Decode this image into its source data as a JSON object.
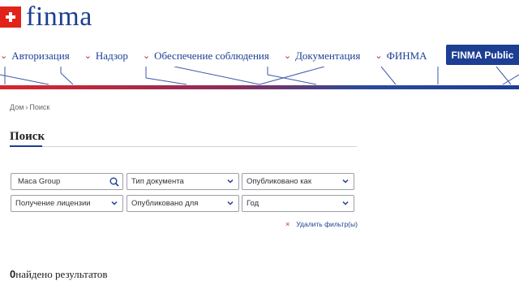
{
  "brand": {
    "logo_text": "finma",
    "public_button": "FINMA Public",
    "colors": {
      "primary": "#1c3f94",
      "accent": "#c0262d",
      "flag": "#e2231a"
    }
  },
  "nav": [
    {
      "label": "Авторизация",
      "icon": "chevron-down-icon"
    },
    {
      "label": "Надзор",
      "icon": "chevron-down-icon"
    },
    {
      "label": "Обеспечение соблюдения",
      "icon": "chevron-down-icon"
    },
    {
      "label": "Документация",
      "icon": "chevron-down-icon"
    },
    {
      "label": "ФИНМА",
      "icon": "chevron-down-icon"
    }
  ],
  "breadcrumb": {
    "home": "Дом",
    "separator": "›",
    "current": "Поиск"
  },
  "page_title": "Поиск",
  "filters": {
    "search_value": "Maca Group",
    "doc_type": "Тип документа",
    "published_as": "Опубликовано как",
    "licensing": "Получение лицензии",
    "published_for": "Опубликовано для",
    "year": "Год",
    "clear_icon": "×",
    "clear_label": "Удалить фильтр(ы)"
  },
  "results": {
    "count": "0",
    "label": "найдено результатов"
  }
}
